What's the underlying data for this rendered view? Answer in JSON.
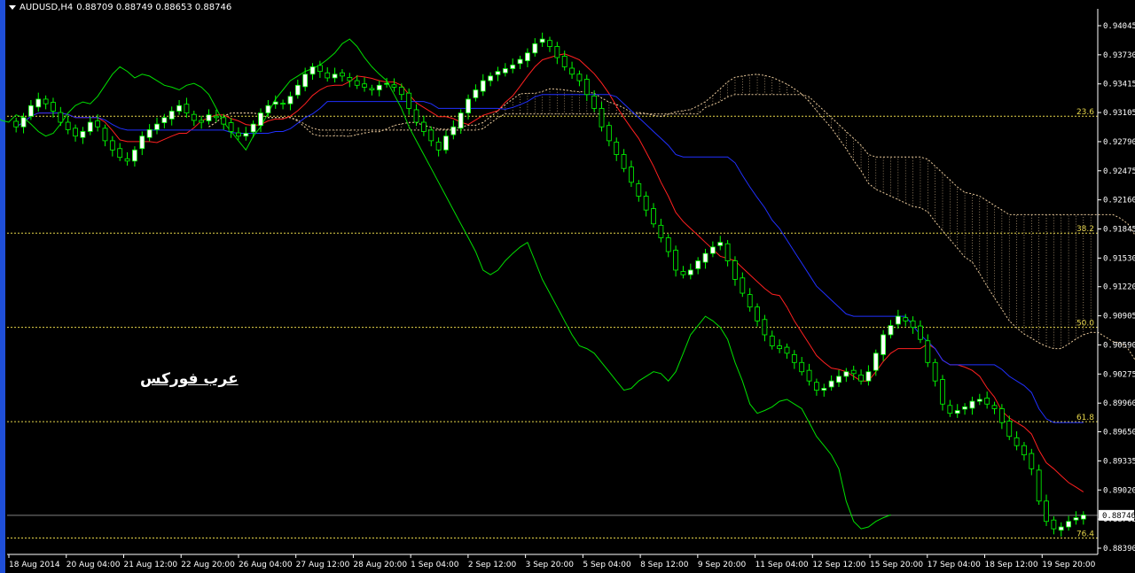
{
  "header": {
    "symbol": "AUDUSD,H4",
    "ohlc": "0.88709 0.88749 0.88653 0.88746"
  },
  "watermark": "عرب فوركس",
  "colors": {
    "background": "#000000",
    "bull_candle": "#ffffff",
    "bear_candle": "#000000",
    "candle_outline": "#00ff00",
    "tenkan": "#ff2020",
    "kijun": "#2030ff",
    "chikou": "#00e000",
    "cloud": "#e8c89a",
    "fib_line": "#e6d54a",
    "current_price_line": "#808080"
  },
  "chart_data": {
    "type": "candlestick",
    "instrument": "AUDUSD",
    "timeframe": "H4",
    "y_range": [
      0.8839,
      0.94045
    ],
    "y_ticks": [
      "0.94045",
      "0.93730",
      "0.93415",
      "0.93105",
      "0.92790",
      "0.92475",
      "0.92160",
      "0.91845",
      "0.91530",
      "0.91220",
      "0.90905",
      "0.90590",
      "0.90275",
      "0.89960",
      "0.89650",
      "0.89335",
      "0.89020",
      "0.88705",
      "0.88390"
    ],
    "x_ticks": [
      "18 Aug 2014",
      "20 Aug 04:00",
      "21 Aug 12:00",
      "22 Aug 20:00",
      "26 Aug 04:00",
      "27 Aug 12:00",
      "28 Aug 20:00",
      "1 Sep 04:00",
      "2 Sep 12:00",
      "3 Sep 20:00",
      "5 Sep 04:00",
      "8 Sep 12:00",
      "9 Sep 20:00",
      "11 Sep 04:00",
      "12 Sep 12:00",
      "15 Sep 20:00",
      "17 Sep 04:00",
      "18 Sep 12:00",
      "19 Sep 20:00"
    ],
    "current_price": "0.88746",
    "fib_levels": [
      {
        "label": "23.6",
        "price": 0.93065
      },
      {
        "label": "38.2",
        "price": 0.918
      },
      {
        "label": "50.0",
        "price": 0.9078
      },
      {
        "label": "61.8",
        "price": 0.8976
      },
      {
        "label": "76.4",
        "price": 0.885
      }
    ],
    "close": [
      0.9295,
      0.9305,
      0.9318,
      0.9325,
      0.932,
      0.9312,
      0.93,
      0.9292,
      0.9285,
      0.929,
      0.93,
      0.9295,
      0.928,
      0.927,
      0.9262,
      0.9258,
      0.927,
      0.9285,
      0.9292,
      0.9298,
      0.9305,
      0.9312,
      0.9318,
      0.931,
      0.9302,
      0.93,
      0.9308,
      0.9305,
      0.9298,
      0.929,
      0.9285,
      0.9288,
      0.9298,
      0.931,
      0.9318,
      0.9322,
      0.932,
      0.9328,
      0.934,
      0.9352,
      0.936,
      0.9355,
      0.9348,
      0.9352,
      0.935,
      0.9345,
      0.934,
      0.9338,
      0.9335,
      0.934,
      0.9342,
      0.9338,
      0.933,
      0.9315,
      0.93,
      0.929,
      0.928,
      0.927,
      0.9285,
      0.9295,
      0.931,
      0.9325,
      0.9335,
      0.9345,
      0.935,
      0.9355,
      0.9358,
      0.9362,
      0.9368,
      0.9375,
      0.9385,
      0.939,
      0.9382,
      0.937,
      0.936,
      0.9352,
      0.9345,
      0.933,
      0.9315,
      0.9295,
      0.928,
      0.9265,
      0.925,
      0.9235,
      0.922,
      0.9205,
      0.919,
      0.9175,
      0.916,
      0.914,
      0.9135,
      0.914,
      0.915,
      0.9158,
      0.9165,
      0.917,
      0.915,
      0.913,
      0.9115,
      0.91,
      0.9085,
      0.907,
      0.9058,
      0.9055,
      0.905,
      0.904,
      0.903,
      0.902,
      0.901,
      0.9012,
      0.902,
      0.9025,
      0.903,
      0.9028,
      0.902,
      0.903,
      0.905,
      0.907,
      0.908,
      0.909,
      0.9085,
      0.9078,
      0.9065,
      0.904,
      0.902,
      0.8995,
      0.8985,
      0.8988,
      0.8992,
      0.8998,
      0.9,
      0.8995,
      0.899,
      0.8975,
      0.896,
      0.895,
      0.894,
      0.8925,
      0.889,
      0.8868,
      0.886,
      0.8862,
      0.8868,
      0.8872,
      0.8875
    ]
  }
}
